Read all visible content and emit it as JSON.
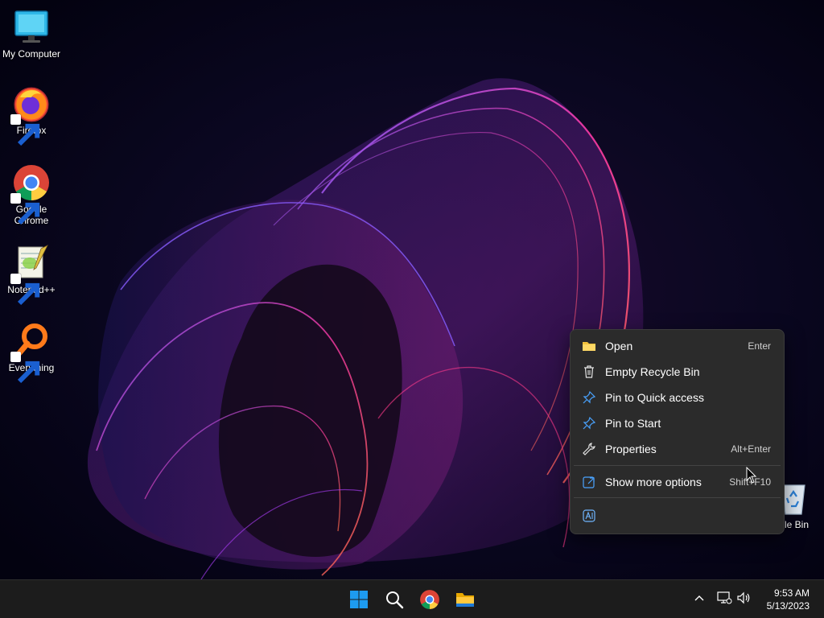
{
  "desktop": {
    "icons": [
      {
        "label": "My Computer"
      },
      {
        "label": "Firefox"
      },
      {
        "label": "Google\nChrome"
      },
      {
        "label": "Notepad++"
      },
      {
        "label": "Everything"
      },
      {
        "label": "le Bin"
      }
    ]
  },
  "context_menu": {
    "items": [
      {
        "label": "Open",
        "shortcut": "Enter",
        "icon": "folder-icon"
      },
      {
        "label": "Empty Recycle Bin",
        "shortcut": "",
        "icon": "trash-icon"
      },
      {
        "label": "Pin to Quick access",
        "shortcut": "",
        "icon": "pin-icon"
      },
      {
        "label": "Pin to Start",
        "shortcut": "",
        "icon": "pin-icon"
      },
      {
        "label": "Properties",
        "shortcut": "Alt+Enter",
        "icon": "wrench-icon"
      },
      {
        "label": "Show more options",
        "shortcut": "Shift+F10",
        "icon": "external-link-icon"
      }
    ],
    "footer_icon": "ai-assist-icon"
  },
  "taskbar": {
    "apps": [
      "start-button",
      "search-button",
      "chrome-taskbar",
      "file-explorer-taskbar"
    ],
    "clock": {
      "time": "9:53 AM",
      "date": "5/13/2023"
    }
  },
  "colors": {
    "taskbar_bg": "#1c1c1c",
    "menu_bg": "#2b2b2b",
    "accent": "#0078d4"
  }
}
